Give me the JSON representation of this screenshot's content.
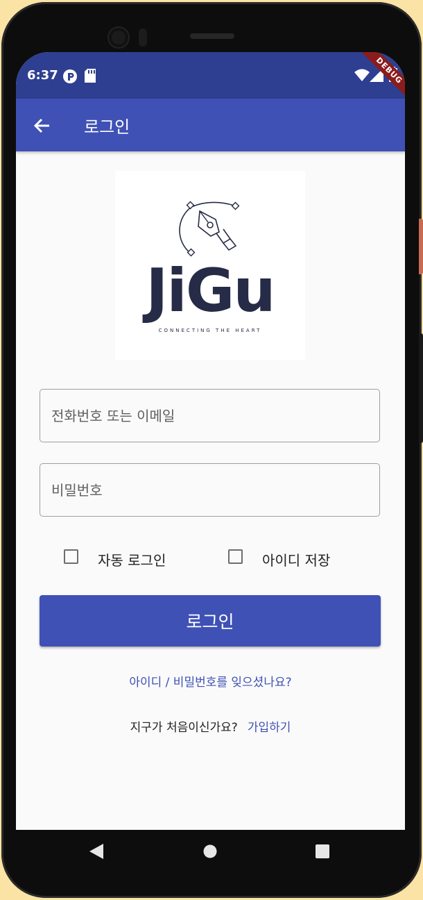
{
  "statusbar": {
    "time": "6:37",
    "icons": [
      "p-circle-icon",
      "sd-card-icon",
      "wifi-icon",
      "signal-icon",
      "battery-icon"
    ],
    "debug_banner": "DEBUG"
  },
  "appbar": {
    "title": "로그인",
    "back_icon": "arrow-back-icon",
    "color": "#3f51b5",
    "statusbar_color": "#2e3f91"
  },
  "logo": {
    "wordmark": "JiGu",
    "tagline": "CONNECTING THE HEART"
  },
  "form": {
    "id_placeholder": "전화번호 또는 이메일",
    "id_value": "",
    "password_placeholder": "비밀번호",
    "password_value": "",
    "auto_login_label": "자동 로그인",
    "auto_login_checked": false,
    "save_id_label": "아이디 저장",
    "save_id_checked": false,
    "login_button": "로그인"
  },
  "links": {
    "forgot": "아이디 / 비밀번호를 잊으셨나요?",
    "signup_question": "지구가 처음이신가요?",
    "signup_link": "가입하기"
  },
  "navbar": {
    "icons": [
      "back-triangle-icon",
      "home-circle-icon",
      "recents-square-icon"
    ]
  }
}
